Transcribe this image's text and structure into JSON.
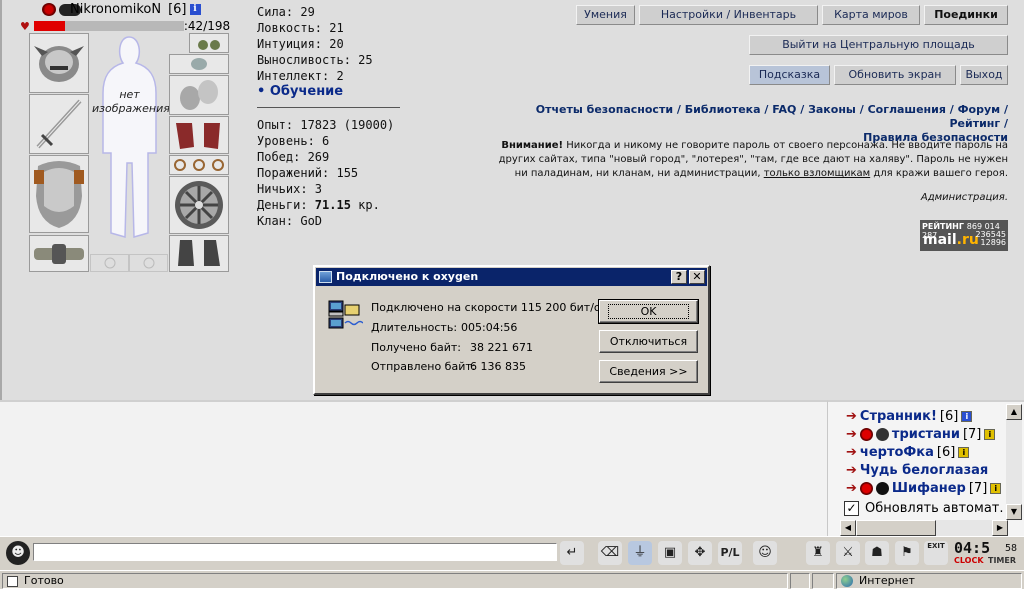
{
  "hero": {
    "name": "NikronomikoN",
    "level": "[6]",
    "hp_text": ":42/198",
    "hp_fraction": 0.21,
    "no_image_label": "нет\nизображения"
  },
  "stats": {
    "strength": "Сила: 29",
    "agility": "Ловкость: 21",
    "intuition": "Интуиция: 20",
    "endurance": "Выносливость: 25",
    "intellect": "Интеллект: 2",
    "training": "Обучение",
    "exp": "Опыт: 17823 (19000)",
    "level": "Уровень: 6",
    "wins": "Побед: 269",
    "losses": "Поражений: 155",
    "draws": "Ничьих: 3",
    "money_label": "Деньги: ",
    "money_value": "71.15",
    "money_unit": " кр.",
    "clan": "Клан: GoD"
  },
  "nav": {
    "skills": "Умения",
    "settings": "Настройки / Инвентарь",
    "map": "Карта миров",
    "duels": "Поединки",
    "exit_square": "Выйти на Центральную площадь",
    "hint": "Подсказка",
    "refresh": "Обновить экран",
    "exit": "Выход"
  },
  "links": {
    "security_reports": "Отчеты безопасности",
    "library": "Библиотека",
    "faq": "FAQ",
    "laws": "Законы",
    "agreements": "Соглашения",
    "forum": "Форум",
    "rating": "Рейтинг",
    "security_rules": "Правила безопасности"
  },
  "warning": {
    "bold": "Внимание!",
    "text1": " Никогда и никому не говорите пароль от своего персонажа. Не вводите пароль на других сайтах, типа \"новый город\", \"лотерея\", \"там, где все дают на халяву\". Пароль не нужен ни паладинам, ни кланам, ни администрации, ",
    "underlined": "только взломщикам",
    "text2": " для кражи вашего героя.",
    "admin": "Администрация."
  },
  "rating_counter": {
    "title": "РЕЙТИНГ",
    "nums_top": "869 014 287",
    "logo_a": "mail",
    "logo_b": ".ru",
    "n1": "236545",
    "n2": "12896"
  },
  "dialog": {
    "title": "Подключено к oxygen",
    "help_btn": "?",
    "close_btn": "✕",
    "speed": "Подключено на скорости 115 200 бит/с",
    "duration_label": "Длительность:",
    "duration": "005:04:56",
    "received_label": "Получено байт:",
    "received": "38 221 671",
    "sent_label": "Отправлено байт:",
    "sent": "6 136 835",
    "ok": "OK",
    "disconnect": "Отключиться",
    "details": "Сведения >>"
  },
  "users": [
    {
      "name": "Странник!",
      "level": "[6]",
      "info": "blue"
    },
    {
      "name": "тристани",
      "level": "[7]",
      "info": "yellow"
    },
    {
      "name": "чертоФка",
      "level": "[6]",
      "info": "yellow"
    },
    {
      "name": "Чудь белоглазая",
      "level": "",
      "info": ""
    },
    {
      "name": "Шифанер",
      "level": "[7]",
      "info": "yellow"
    }
  ],
  "auto_refresh": "Обновлять автомат.",
  "clock": {
    "time": "04:5",
    "sec": "58",
    "clock_label": "CLOCK",
    "timer_label": "TIMER",
    "exit_label": "EXIT"
  },
  "statusbar": {
    "ready": "Готово",
    "zone": "Интернет"
  }
}
